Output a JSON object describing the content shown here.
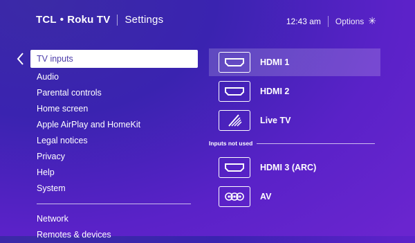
{
  "header": {
    "brand_left": "TCL",
    "brand_dot": "•",
    "brand_right": "Roku TV",
    "section_title": "Settings",
    "time": "12:43 am",
    "options_label": "Options",
    "options_icon": "asterisk-icon"
  },
  "menu": {
    "items": [
      {
        "label": "TV inputs",
        "selected": true
      },
      {
        "label": "Audio"
      },
      {
        "label": "Parental controls"
      },
      {
        "label": "Home screen"
      },
      {
        "label": "Apple AirPlay and HomeKit"
      },
      {
        "label": "Legal notices"
      },
      {
        "label": "Privacy"
      },
      {
        "label": "Help"
      },
      {
        "label": "System"
      }
    ],
    "more_items": [
      {
        "label": "Network"
      },
      {
        "label": "Remotes & devices"
      }
    ]
  },
  "inputs": {
    "used": [
      {
        "label": "HDMI 1",
        "icon": "hdmi-icon",
        "selected": true
      },
      {
        "label": "HDMI 2",
        "icon": "hdmi-icon"
      },
      {
        "label": "Live TV",
        "icon": "antenna-icon"
      }
    ],
    "unused_header": "Inputs not used",
    "unused": [
      {
        "label": "HDMI 3 (ARC)",
        "icon": "hdmi-icon"
      },
      {
        "label": "AV",
        "icon": "av-ports-icon"
      }
    ]
  },
  "colors": {
    "background": "#4a24bf",
    "selected_text": "#4a3aa8",
    "selected_bg": "#ffffff"
  }
}
